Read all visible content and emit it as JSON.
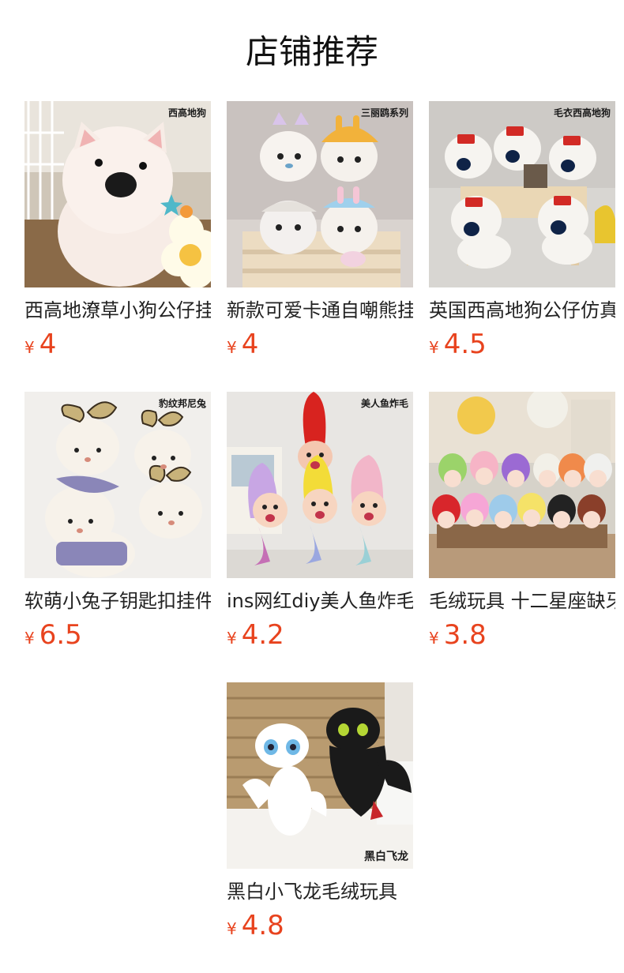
{
  "page_title": "店铺推荐",
  "currency": "¥",
  "colors": {
    "price": "#e8431e",
    "text": "#222222",
    "title": "#111111"
  },
  "products": [
    {
      "name": "西高地潦草小狗公仔挂件",
      "price": "4",
      "image_label": "西高地狗"
    },
    {
      "name": "新款可爱卡通自嘲熊挂件",
      "price": "4",
      "image_label": "三丽鸥系列"
    },
    {
      "name": "英国西高地狗公仔仿真",
      "price": "4.5",
      "image_label": "毛衣西高地狗"
    },
    {
      "name": "软萌小兔子钥匙扣挂件",
      "price": "6.5",
      "image_label": "豹纹邦尼兔"
    },
    {
      "name": "ins网红diy美人鱼炸毛",
      "price": "4.2",
      "image_label": "美人鱼炸毛"
    },
    {
      "name": "毛绒玩具 十二星座缺牙",
      "price": "3.8",
      "image_label": ""
    },
    {
      "name": "黑白小飞龙毛绒玩具",
      "price": "4.8",
      "image_label": "黑白飞龙"
    }
  ]
}
